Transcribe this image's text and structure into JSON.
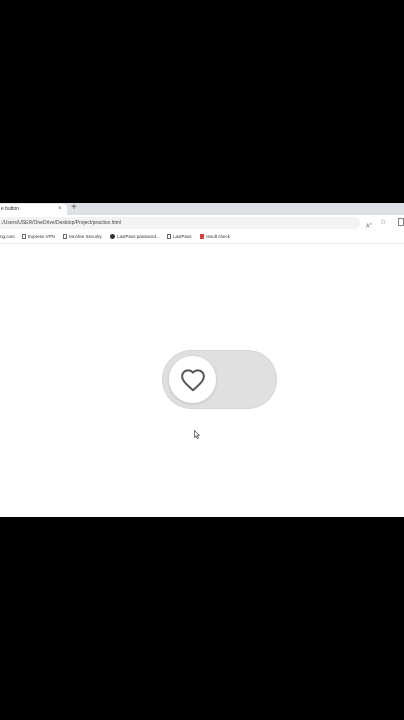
{
  "tab": {
    "title": "e button",
    "close": "×",
    "new_tab": "+"
  },
  "address": {
    "url": ":/Users/USER/OneDrive/Desktop/Project/practice.html"
  },
  "bookmarks": [
    {
      "label": "ng.com",
      "icon": "none"
    },
    {
      "label": "Express VPN",
      "icon": "page-icon"
    },
    {
      "label": "McAfee Security",
      "icon": "page-icon"
    },
    {
      "label": "LastPass password...",
      "icon": "globe-icon"
    },
    {
      "label": "LastPass",
      "icon": "page-icon"
    },
    {
      "label": "result check",
      "icon": "bookmark-icon"
    }
  ],
  "toolbar_icons": {
    "read_aloud": "A",
    "favorite": "☆"
  },
  "toggle": {
    "state": "off",
    "icon": "heart-icon",
    "track_color": "#e0e0e0",
    "knob_color": "#ffffff",
    "icon_color": "#555555"
  }
}
